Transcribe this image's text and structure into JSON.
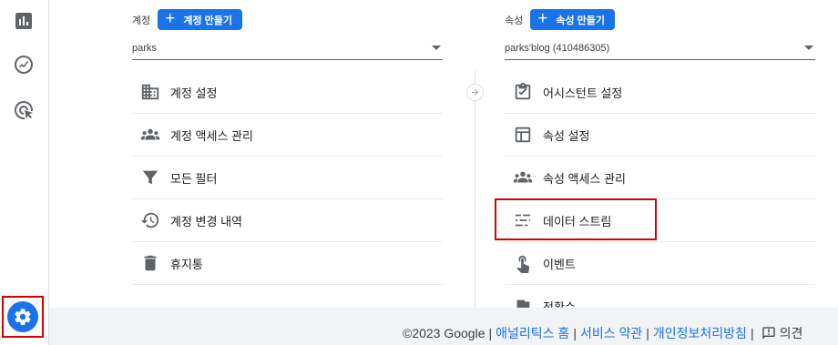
{
  "rail": {
    "icons": [
      "bar-chart-icon",
      "trend-icon",
      "target-cursor-icon"
    ],
    "settings_icon": "gear-icon"
  },
  "account": {
    "label": "계정",
    "create_button": "계정 만들기",
    "selected": "parks",
    "items": [
      {
        "label": "계정 설정",
        "icon": "building-icon"
      },
      {
        "label": "계정 액세스 관리",
        "icon": "people-icon"
      },
      {
        "label": "모든 필터",
        "icon": "filter-icon"
      },
      {
        "label": "계정 변경 내역",
        "icon": "history-icon"
      },
      {
        "label": "휴지통",
        "icon": "trash-icon"
      }
    ]
  },
  "property": {
    "label": "속성",
    "create_button": "속성 만들기",
    "selected": "parks'blog (410486305)",
    "items": [
      {
        "label": "어시스턴트 설정",
        "icon": "clipboard-check-icon"
      },
      {
        "label": "속성 설정",
        "icon": "layout-icon"
      },
      {
        "label": "속성 액세스 관리",
        "icon": "people-icon"
      },
      {
        "label": "데이터 스트림",
        "icon": "data-streams-icon"
      },
      {
        "label": "이벤트",
        "icon": "touch-icon"
      },
      {
        "label": "전환수",
        "icon": "flag-icon"
      }
    ]
  },
  "footer": {
    "copyright": "©2023 Google",
    "sep": "|",
    "links": [
      "애널리틱스 홈",
      "서비스 약관",
      "개인정보처리방침"
    ],
    "feedback": "의견"
  },
  "colors": {
    "accent": "#1a73e8",
    "highlight": "#d50000",
    "icon": "#5f6368"
  }
}
